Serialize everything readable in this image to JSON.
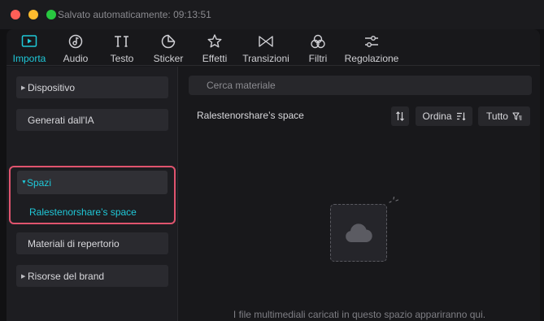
{
  "window": {
    "title": "Salvato automaticamente: 09:13:51"
  },
  "toolbar": {
    "tabs": [
      {
        "label": "Importa",
        "icon": "import-icon",
        "active": true
      },
      {
        "label": "Audio",
        "icon": "audio-icon",
        "active": false
      },
      {
        "label": "Testo",
        "icon": "text-icon",
        "active": false
      },
      {
        "label": "Sticker",
        "icon": "sticker-icon",
        "active": false
      },
      {
        "label": "Effetti",
        "icon": "effects-icon",
        "active": false
      },
      {
        "label": "Transizioni",
        "icon": "transitions-icon",
        "active": false
      },
      {
        "label": "Filtri",
        "icon": "filters-icon",
        "active": false
      },
      {
        "label": "Regolazione",
        "icon": "adjust-icon",
        "active": false
      }
    ]
  },
  "sidebar": {
    "items": [
      {
        "label": "Dispositivo",
        "expandable": true
      },
      {
        "label": "Generati dall'IA",
        "expandable": false
      },
      {
        "label": "Spazi",
        "expandable": true,
        "expanded": true
      },
      {
        "label": "Materiali di repertorio",
        "expandable": false
      },
      {
        "label": "Risorse del brand",
        "expandable": true
      }
    ],
    "spazi_sub": "Ralestenorshare’s space"
  },
  "main": {
    "search_placeholder": "Cerca materiale",
    "space_name": "Ralestenorshare’s space",
    "ordina_label": "Ordina",
    "tutto_label": "Tutto",
    "empty_message": "I file multimediali caricati in questo spazio appariranno qui."
  },
  "colors": {
    "accent": "#1fc8d8",
    "highlight_border": "#e0546e",
    "background": "#18181b"
  }
}
